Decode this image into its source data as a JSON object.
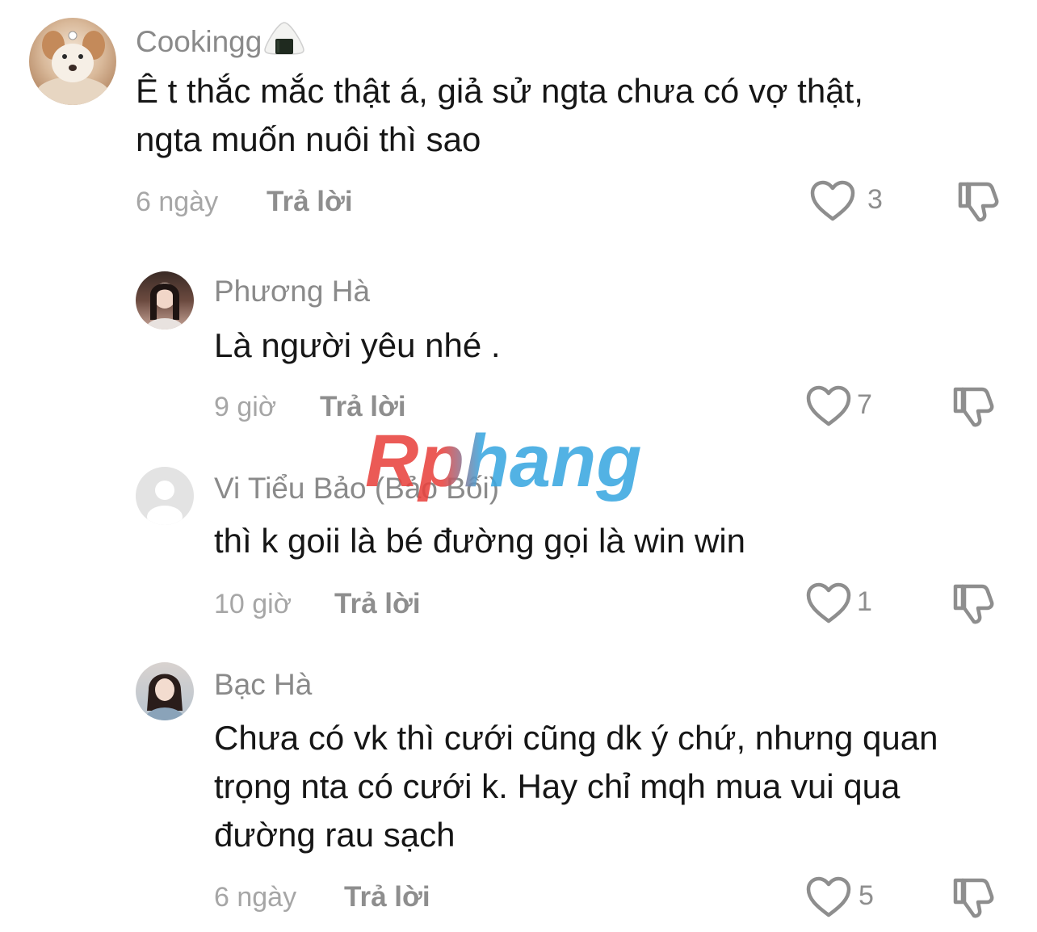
{
  "comments": [
    {
      "username": "Cookingg",
      "username_emoji": "onigiri",
      "lines": [
        "Ê t thắc mắc thật á, giả sử ngta chưa có vợ thật,",
        "ngta muốn nuôi thì sao"
      ],
      "time": "6 ngày",
      "reply": "Trả lời",
      "likes": "3"
    },
    {
      "username": "Phương Hà",
      "lines": [
        "Là người yêu nhé ."
      ],
      "time": "9 giờ",
      "reply": "Trả lời",
      "likes": "7"
    },
    {
      "username": "Vi Tiểu Bảo (Bảo Bối)",
      "lines": [
        "thì k goii là bé đường gọi là win win"
      ],
      "time": "10 giờ",
      "reply": "Trả lời",
      "likes": "1"
    },
    {
      "username": "Bạc Hà",
      "lines": [
        "Chưa có vk thì cưới cũng dk ý chứ, nhưng quan",
        "trọng nta có cưới k. Hay chỉ mqh mua vui qua",
        "đường rau sạch"
      ],
      "time": "6 ngày",
      "reply": "Trả lời",
      "likes": "5"
    }
  ],
  "watermark": {
    "text": "Rphang",
    "colors": [
      "#e8433f",
      "#3aa7e0"
    ]
  },
  "icons": [
    "heart-outline-icon",
    "thumbs-down-icon",
    "default-avatar-icon"
  ],
  "colors": {
    "text": "#161616",
    "muted": "#8a8a8a",
    "time": "#a6a6a6"
  }
}
